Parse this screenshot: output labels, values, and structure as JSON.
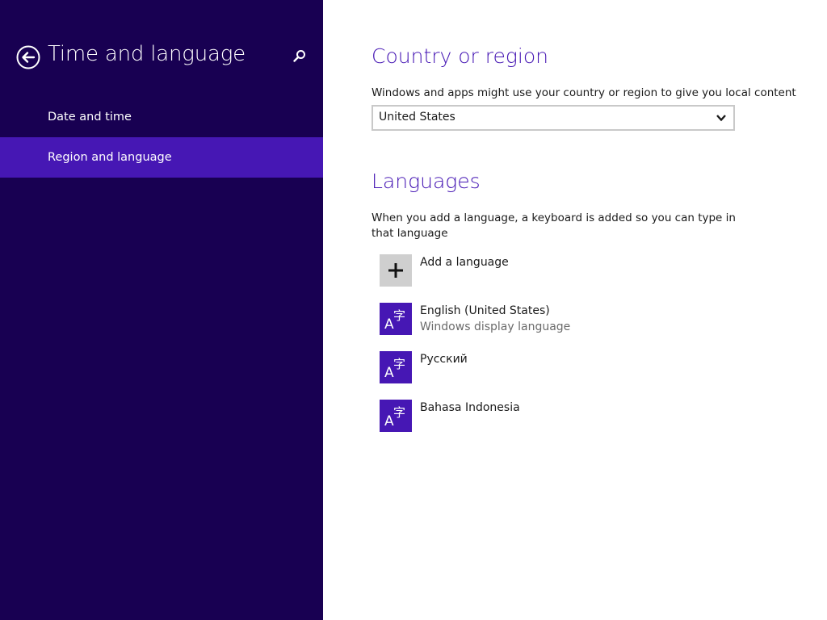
{
  "sidebar": {
    "title": "Time and language",
    "items": [
      {
        "label": "Date and time",
        "selected": false
      },
      {
        "label": "Region and language",
        "selected": true
      }
    ]
  },
  "country": {
    "title": "Country or region",
    "description": "Windows and apps might use your country or region to give you local content",
    "selected": "United States"
  },
  "languages": {
    "title": "Languages",
    "description": "When you add a language, a keyboard is added so you can type in that language",
    "add_label": "Add a language",
    "items": [
      {
        "name": "English (United States)",
        "subtitle": "Windows display language"
      },
      {
        "name": "Русский",
        "subtitle": ""
      },
      {
        "name": "Bahasa Indonesia",
        "subtitle": ""
      }
    ]
  },
  "icons": {
    "back": "back-arrow-icon",
    "search": "search-icon",
    "chevron": "chevron-down-icon",
    "add": "plus-icon",
    "language": "language-glyph-icon"
  },
  "colors": {
    "sidebar_bg": "#180052",
    "accent": "#4617b4",
    "selected_item": "#4617b4",
    "add_tile": "#cfcfcf"
  }
}
